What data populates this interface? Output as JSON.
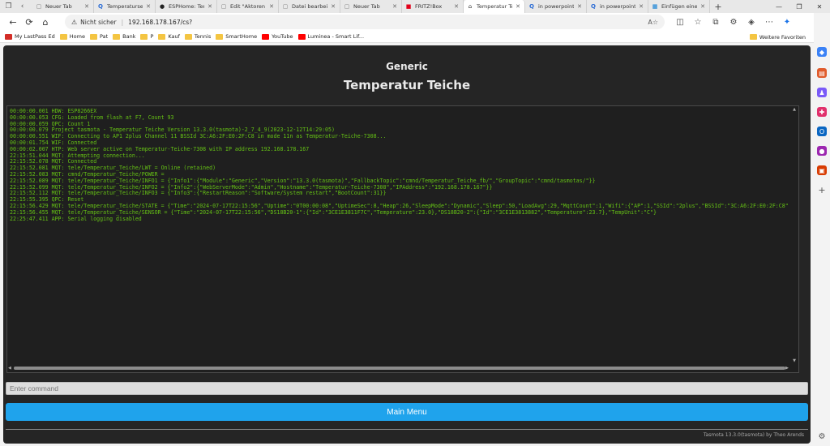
{
  "browser": {
    "tabs": [
      {
        "label": "Neuer Tab",
        "favicon": "page-icon",
        "color": "#777777",
        "active": false
      },
      {
        "label": "Temperatursen",
        "favicon": "search-icon",
        "color": "#2b6cd4",
        "active": false
      },
      {
        "label": "ESPHome: Tem",
        "favicon": "github-icon",
        "color": "#222222",
        "active": false
      },
      {
        "label": "Edit \"Aktoren",
        "favicon": "page-icon",
        "color": "#777777",
        "active": false
      },
      {
        "label": "Datei bearbeite",
        "favicon": "page-icon",
        "color": "#777777",
        "active": false
      },
      {
        "label": "Neuer Tab",
        "favicon": "page-icon",
        "color": "#777777",
        "active": false
      },
      {
        "label": "FRITZ!Box",
        "favicon": "fritz-icon",
        "color": "#e2001a",
        "active": false
      },
      {
        "label": "Temperatur Te",
        "favicon": "tasmota-icon",
        "color": "#333333",
        "active": true
      },
      {
        "label": "in powerpoint a",
        "favicon": "search-icon",
        "color": "#2b6cd4",
        "active": false
      },
      {
        "label": "in powerpoint",
        "favicon": "search-icon",
        "color": "#2b6cd4",
        "active": false
      },
      {
        "label": "Einfügen eines",
        "favicon": "windows-icon",
        "color": "#0078d4",
        "active": false
      }
    ],
    "address": {
      "security_label": "Nicht sicher",
      "url": "192.168.178.167/cs?"
    },
    "bookmarks": [
      {
        "label": "My LastPass Ed",
        "icon": "lastpass-icon",
        "color": "#d32d27"
      },
      {
        "label": "Home",
        "icon": "folder-icon",
        "color": "#f4c542"
      },
      {
        "label": "Pat",
        "icon": "folder-icon",
        "color": "#f4c542"
      },
      {
        "label": "Bank",
        "icon": "folder-icon",
        "color": "#f4c542"
      },
      {
        "label": "P",
        "icon": "folder-icon",
        "color": "#f4c542"
      },
      {
        "label": "Kauf",
        "icon": "folder-icon",
        "color": "#f4c542"
      },
      {
        "label": "Tennis",
        "icon": "folder-icon",
        "color": "#f4c542"
      },
      {
        "label": "SmartHome",
        "icon": "folder-icon",
        "color": "#f4c542"
      },
      {
        "label": "YouTube",
        "icon": "youtube-icon",
        "color": "#ff0000"
      },
      {
        "label": "Luminea - Smart Lif...",
        "icon": "youtube-icon",
        "color": "#ff0000"
      }
    ],
    "bookmarks_other": "Weitere Favoriten"
  },
  "page": {
    "device_name": "Generic",
    "device_title": "Temperatur Teiche",
    "console_lines": [
      "00:00:00.001 HDW: ESP8266EX",
      "00:00:00.053 CFG: Loaded from flash at F7, Count 93",
      "00:00:00.059 QPC: Count 1",
      "00:00:00.079 Project tasmota - Temperatur Teiche Version 13.3.0(tasmota)-2_7_4_9(2023-12-12T14:29:05)",
      "00:00:00.551 WIF: Connecting to AP1 2plus Channel 11 BSSId 3C:A6:2F:E0:2F:C8 in mode 11n as Temperatur-Teiche-7308...",
      "00:00:01.754 WIF: Connected",
      "00:00:02.007 HTP: Web server active on Temperatur-Teiche-7308 with IP address 192.168.178.167",
      "22:15:51.044 MQT: Attempting connection...",
      "22:15:52.078 MQT: Connected",
      "22:15:52.081 MQT: tele/Temperatur_Teiche/LWT = Online (retained)",
      "22:15:52.083 MQT: cmnd/Temperatur_Teiche/POWER =",
      "22:15:52.089 MQT: tele/Temperatur_Teiche/INFO1 = {\"Info1\":{\"Module\":\"Generic\",\"Version\":\"13.3.0(tasmota)\",\"FallbackTopic\":\"cmnd/Temperatur_Teiche_fb/\",\"GroupTopic\":\"cmnd/tasmotas/\"}}",
      "22:15:52.099 MQT: tele/Temperatur_Teiche/INFO2 = {\"Info2\":{\"WebServerMode\":\"Admin\",\"Hostname\":\"Temperatur-Teiche-7308\",\"IPAddress\":\"192.168.178.167\"}}",
      "22:15:52.112 MQT: tele/Temperatur_Teiche/INFO3 = {\"Info3\":{\"RestartReason\":\"Software/System restart\",\"BootCount\":31}}",
      "22:15:55.395 QPC: Reset",
      "22:15:56.429 MQT: tele/Temperatur_Teiche/STATE = {\"Time\":\"2024-07-17T22:15:56\",\"Uptime\":\"0T00:00:08\",\"UptimeSec\":8,\"Heap\":26,\"SleepMode\":\"Dynamic\",\"Sleep\":50,\"LoadAvg\":29,\"MqttCount\":1,\"Wifi\":{\"AP\":1,\"SSId\":\"2plus\",\"BSSId\":\"3C:A6:2F:E0:2F:C8\",\"Channel\"",
      "22:15:56.455 MQT: tele/Temperatur_Teiche/SENSOR = {\"Time\":\"2024-07-17T22:15:56\",\"DS18B20-1\":{\"Id\":\"3CE1E3811F7C\",\"Temperature\":23.0},\"DS18B20-2\":{\"Id\":\"3CE1E3813882\",\"Temperature\":23.7},\"TempUnit\":\"C\"}",
      "22:25:47.411 APP: Serial logging disabled"
    ],
    "command_placeholder": "Enter command",
    "main_menu_label": "Main Menu",
    "footer": "Tasmota 13.3.0(tasmota) by Theo Arends",
    "colors": {
      "background": "#252525",
      "console_text": "#65c115",
      "button": "#1fa3ec"
    }
  }
}
